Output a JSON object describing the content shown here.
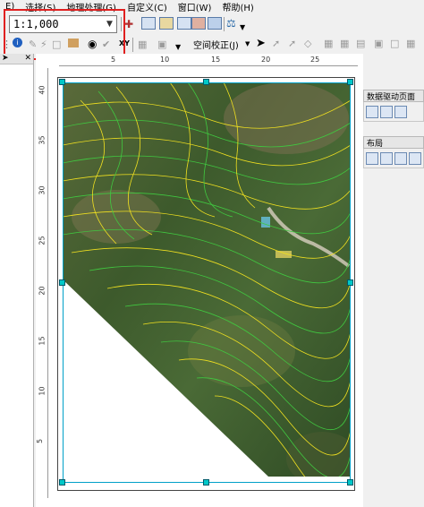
{
  "menu": {
    "items": [
      "E)",
      "选择(S)",
      "地理处理(G)",
      "自定义(C)",
      "窗口(W)",
      "帮助(H)"
    ]
  },
  "toolbar": {
    "scale_value": "1:1,000",
    "georef_label": "空间校正(J)"
  },
  "left_panel": {
    "pin_icon": "pin-icon",
    "close_icon": "close-icon"
  },
  "rulers": {
    "horizontal_labels": [
      "5",
      "10",
      "15",
      "20",
      "25"
    ],
    "vertical_labels": [
      "40",
      "35",
      "30",
      "25",
      "20",
      "15",
      "10",
      "5"
    ]
  },
  "right_panel": {
    "data_driven_title": "数据驱动页面",
    "layout_title": "布局"
  },
  "colors": {
    "highlight_box": "#e02020",
    "frame_border": "#00a0c8",
    "handle_fill": "#00c8c8",
    "contour_yellow": "#f0e020",
    "contour_green": "#40c840",
    "terrain_dark": "#3a5a2a"
  }
}
